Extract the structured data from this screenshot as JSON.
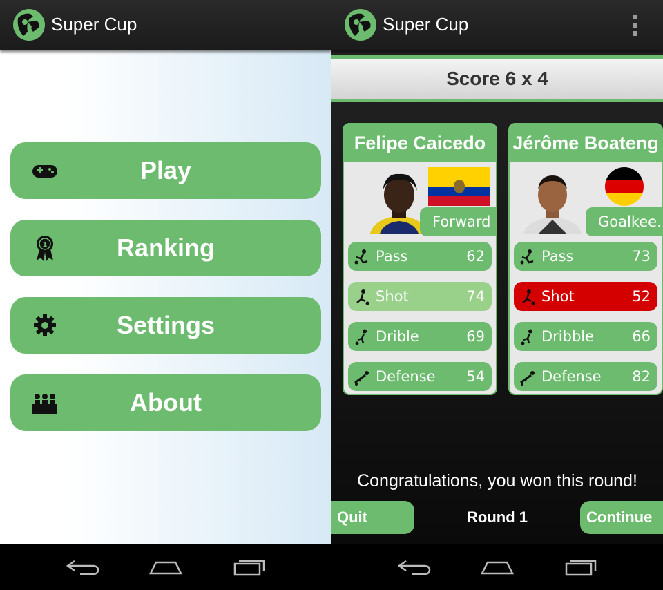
{
  "app": {
    "title": "Super Cup",
    "logo_icon": "soccer-ball-trophy-icon"
  },
  "menu": {
    "play_label": "Play",
    "ranking_label": "Ranking",
    "settings_label": "Settings",
    "about_label": "About",
    "icons": [
      "gamepad-icon",
      "ribbon-medal-icon",
      "gear-icon",
      "audience-icon"
    ]
  },
  "game": {
    "score": "Score 6 x 4",
    "message": "Congratulations, you won this round!",
    "round_label": "Round 1",
    "quit_label": "Quit",
    "continue_label": "Continue"
  },
  "players": [
    {
      "name": "Felipe Caicedo",
      "position": "Forward",
      "flag": "ecuador-flag",
      "stats": [
        {
          "label": "Pass",
          "value": "62",
          "icon": "pass-icon"
        },
        {
          "label": "Shot",
          "value": "74",
          "icon": "shot-icon",
          "state": "win"
        },
        {
          "label": "Drible",
          "value": "69",
          "icon": "dribble-icon"
        },
        {
          "label": "Defense",
          "value": "54",
          "icon": "defense-icon"
        }
      ]
    },
    {
      "name": "Jérôme Boateng",
      "position": "Goalkee...",
      "flag": "germany-flag",
      "stats": [
        {
          "label": "Pass",
          "value": "73",
          "icon": "pass-icon"
        },
        {
          "label": "Shot",
          "value": "52",
          "icon": "shot-icon",
          "state": "lose"
        },
        {
          "label": "Dribble",
          "value": "66",
          "icon": "dribble-icon"
        },
        {
          "label": "Defense",
          "value": "82",
          "icon": "defense-icon"
        }
      ]
    }
  ],
  "colors": {
    "accent": "#6cbb6e",
    "win": "#9ad18a",
    "lose": "#d40000"
  },
  "navbar": {
    "icons": [
      "back-icon",
      "home-icon",
      "recent-apps-icon"
    ]
  }
}
